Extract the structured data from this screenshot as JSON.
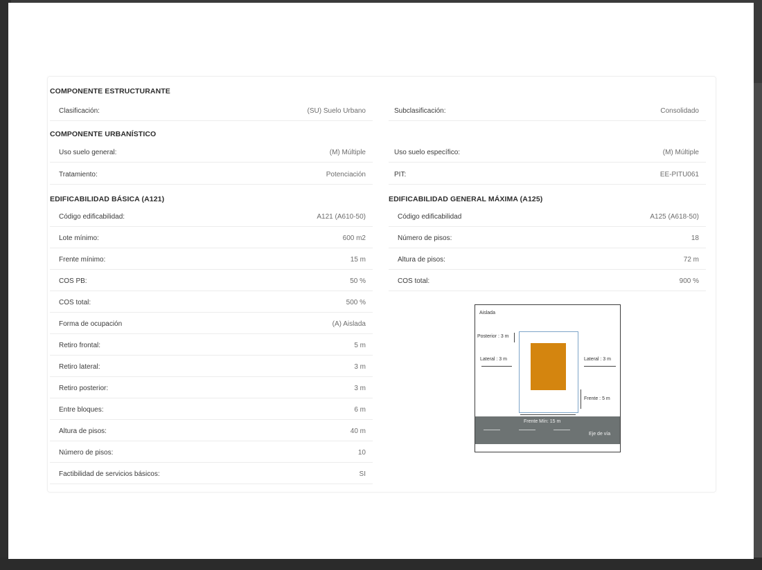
{
  "sections": {
    "estructurante": {
      "title": "COMPONENTE ESTRUCTURANTE",
      "left": {
        "label": "Clasificación:",
        "value": "(SU) Suelo Urbano"
      },
      "right": {
        "label": "Subclasificación:",
        "value": "Consolidado"
      }
    },
    "urbanistico": {
      "title": "COMPONENTE URBANÍSTICO",
      "rows": [
        {
          "left": {
            "label": "Uso suelo general:",
            "value": "(M) Múltiple"
          },
          "right": {
            "label": "Uso suelo específico:",
            "value": "(M) Múltiple"
          }
        },
        {
          "left": {
            "label": "Tratamiento:",
            "value": "Potenciación"
          },
          "right": {
            "label": "PIT:",
            "value": "EE-PITU061"
          }
        }
      ]
    },
    "basica": {
      "title": "EDIFICABILIDAD BÁSICA (A121)",
      "rows": [
        {
          "label": "Código edificabilidad:",
          "value": "A121 (A610-50)"
        },
        {
          "label": "Lote mínimo:",
          "value": "600 m2"
        },
        {
          "label": "Frente mínimo:",
          "value": "15 m"
        },
        {
          "label": "COS PB:",
          "value": "50 %"
        },
        {
          "label": "COS total:",
          "value": "500 %"
        },
        {
          "label": "Forma de ocupación",
          "value": "(A) Aislada"
        },
        {
          "label": "Retiro frontal:",
          "value": "5 m"
        },
        {
          "label": "Retiro lateral:",
          "value": "3 m"
        },
        {
          "label": "Retiro posterior:",
          "value": "3 m"
        },
        {
          "label": "Entre bloques:",
          "value": "6 m"
        },
        {
          "label": "Altura de pisos:",
          "value": "40 m"
        },
        {
          "label": "Número de pisos:",
          "value": "10"
        },
        {
          "label": "Factibilidad de servicios básicos:",
          "value": "SI"
        }
      ]
    },
    "maxima": {
      "title": "EDIFICABILIDAD GENERAL MÁXIMA (A125)",
      "rows": [
        {
          "label": "Código edificabilidad",
          "value": "A125 (A618-50)"
        },
        {
          "label": "Número de pisos:",
          "value": "18"
        },
        {
          "label": "Altura de pisos:",
          "value": "72 m"
        },
        {
          "label": "COS total:",
          "value": "900 %"
        }
      ]
    }
  },
  "diagram": {
    "type_label": "Aislada",
    "posterior": "Posterior : 3 m",
    "lateral_left": "Lateral : 3 m",
    "lateral_right": "Lateral : 3 m",
    "frente": "Frente : 5 m",
    "frente_min": "Frente Mín: 15 m",
    "eje_via": "Eje de vía",
    "colors": {
      "building": "#d4850f",
      "road": "#6d7373",
      "lot_border": "#7ca4c8"
    }
  }
}
